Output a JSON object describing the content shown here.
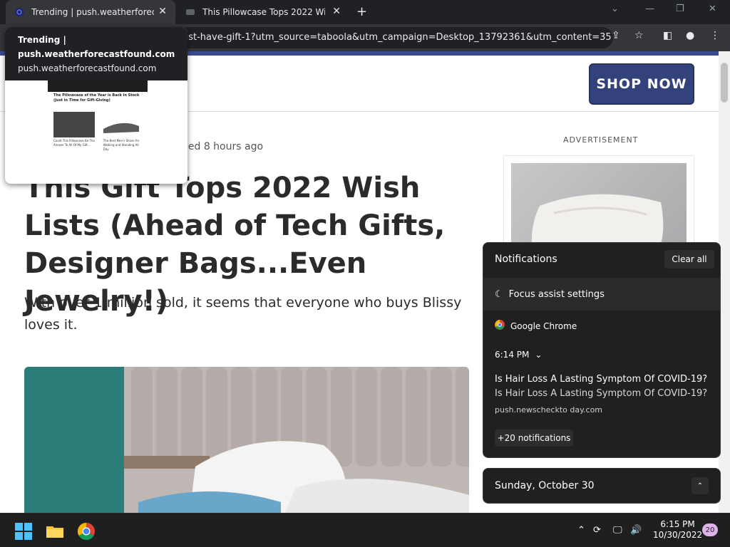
{
  "browser": {
    "tabs": [
      {
        "title": "Trending | push.weatherforecastfo",
        "active": true
      },
      {
        "title": "This Pillowcase Tops 2022 Wish Lis",
        "active": false
      }
    ],
    "url": "ust-have-gift-1?utm_source=taboola&utm_campaign=Desktop_13792361&utm_content=357..."
  },
  "hover_card": {
    "title": "Trending | push.weatherforecastfound.com",
    "url": "push.weatherforecastfound.com",
    "thumb": {
      "headline": "The Pillowcase of the Year is Back in Stock (Just in Time for Gift-Giving)",
      "caption1": "Could This Pillowcase Be The Answer To All Of My Gift...",
      "caption2": "The Best Men's Shoes for Walking and Standing All Day"
    }
  },
  "page": {
    "shop_button": "SHOP NOW",
    "published": "hed 8 hours ago",
    "headline": "This Gift Tops 2022 Wish Lists (Ahead of Tech Gifts, Designer Bags...Even Jewelry!)",
    "subhead": "With over 1 million sold, it seems that everyone who buys Blissy loves it.",
    "ad_label": "ADVERTISEMENT"
  },
  "notifications": {
    "title": "Notifications",
    "clear_all": "Clear all",
    "focus_assist": "Focus assist settings",
    "app": "Google Chrome",
    "time": "6:14 PM",
    "item_title": "Is Hair Loss A Lasting Symptom Of COVID-19?",
    "item_body": "Is Hair Loss A Lasting Symptom Of COVID-19?",
    "item_source": "push.newscheckto day.com",
    "more": "+20 notifications"
  },
  "calendar": {
    "date": "Sunday, October 30"
  },
  "taskbar": {
    "time": "6:15 PM",
    "date": "10/30/2022",
    "badge": "20"
  },
  "colors": {
    "brand": "#33427a",
    "chrome_dark": "#202124",
    "panel": "#202020"
  }
}
